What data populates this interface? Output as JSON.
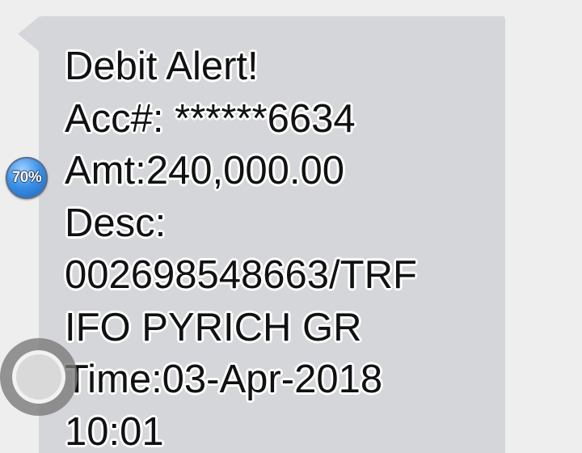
{
  "message": {
    "lines": [
      "Debit Alert!",
      "Acc#: ******6634",
      "Amt:240,000.00",
      "Desc:",
      "002698548663/TRF",
      "IFO PYRICH GR",
      "Time:03-Apr-2018",
      "10:01"
    ]
  },
  "overlay": {
    "battery_text": "70%",
    "battery_icon": "battery-badge-icon",
    "assistive_icon": "assistive-touch-icon"
  },
  "colors": {
    "background": "#eeeeee",
    "bubble": "#d4d6d9",
    "text": "#111111",
    "badge": "#3a8fe6"
  }
}
